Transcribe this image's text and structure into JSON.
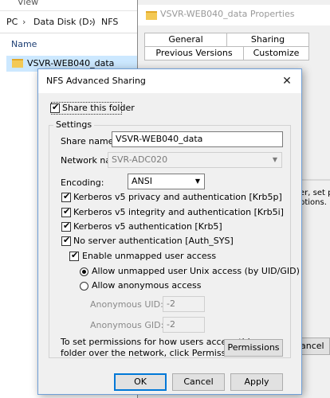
{
  "explorer": {
    "menu_view": "View",
    "breadcrumb": [
      "PC",
      "Data Disk (D:)",
      "NFS"
    ],
    "breadcrumb_sep": "›",
    "column_name": "Name",
    "row": {
      "name": "VSVR-WEB040_data"
    }
  },
  "properties": {
    "title": "VSVR-WEB040_data Properties",
    "tabs_row1": [
      "General",
      "Sharing"
    ],
    "tabs_row2": [
      "Previous Versions",
      "Customize"
    ],
    "fragment_line1": "er, set pe",
    "fragment_line2": "ptions.",
    "cancel_fragment": "ancel"
  },
  "dialog": {
    "title": "NFS Advanced Sharing",
    "close_glyph": "✕",
    "share_this_folder": {
      "label": "Share this folder",
      "checked": true
    },
    "settings_legend": "Settings",
    "share_name": {
      "label": "Share name:",
      "value": "VSVR-WEB040_data"
    },
    "network_name": {
      "label": "Network name:",
      "value": "SVR-ADC020",
      "arrow": "▼"
    },
    "encoding": {
      "label": "Encoding:",
      "value": "ANSI",
      "arrow": "▼"
    },
    "auth_options": [
      {
        "label": "Kerberos v5 privacy and authentication [Krb5p]",
        "checked": true
      },
      {
        "label": "Kerberos v5 integrity and authentication [Krb5i]",
        "checked": true
      },
      {
        "label": "Kerberos v5 authentication [Krb5]",
        "checked": true
      },
      {
        "label": "No server authentication [Auth_SYS]",
        "checked": true
      }
    ],
    "enable_unmapped": {
      "label": "Enable unmapped user access",
      "checked": true
    },
    "radio_unix": {
      "label": "Allow unmapped user Unix access (by UID/GID)",
      "checked": true
    },
    "radio_anonymous": {
      "label": "Allow anonymous access",
      "checked": false
    },
    "anon_uid": {
      "label": "Anonymous UID:",
      "value": "-2"
    },
    "anon_gid": {
      "label": "Anonymous GID:",
      "value": "-2"
    },
    "permissions_text_line1": "To set permissions for how users access this",
    "permissions_text_line2": "folder over the network, click Permissions",
    "buttons": {
      "permissions": "Permissions",
      "ok": "OK",
      "cancel": "Cancel",
      "apply": "Apply"
    }
  }
}
